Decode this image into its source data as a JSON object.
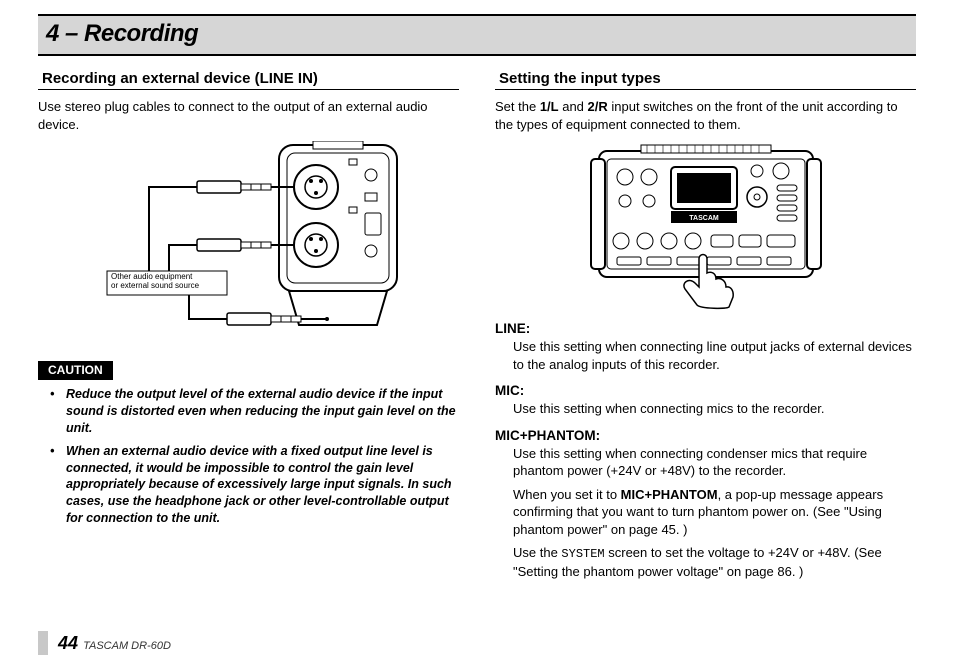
{
  "chapter": {
    "title": "4 – Recording"
  },
  "left": {
    "heading": "Recording an external device (LINE IN)",
    "intro": "Use stereo plug cables to connect to the output of an external audio device.",
    "diagram_callout_line1": "Other audio equipment",
    "diagram_callout_line2": "or external sound source",
    "caution_label": "CAUTION",
    "cautions": [
      "Reduce the output level of the external audio device if the input sound is distorted even when reducing the input gain level on the unit.",
      "When an external audio device with a fixed output line level is connected, it would be impossible to control the gain level appropriately because of excessively large input signals. In such cases, use the headphone jack or other level-controllable output for connection to the unit."
    ]
  },
  "right": {
    "heading": "Setting the input types",
    "intro_pre": "Set the ",
    "intro_bold1": "1/L",
    "intro_mid": " and ",
    "intro_bold2": "2/R",
    "intro_post": " input switches on the front of the unit according to the types of equipment connected to them.",
    "device_brand": "TASCAM",
    "settings": {
      "line": {
        "head": "LINE:",
        "body": "Use this setting when connecting line output jacks of external devices to the analog inputs of this recorder."
      },
      "mic": {
        "head": "MIC:",
        "body": "Use this setting when connecting mics to the recorder."
      },
      "phantom": {
        "head": "MIC+PHANTOM:",
        "body1": "Use this setting when connecting condenser mics that require phantom power (+24V or +48V) to the recorder.",
        "body2_pre": "When you set it to ",
        "body2_bold": "MIC+PHANTOM",
        "body2_post": ", a pop-up message appears confirming that you want to turn phantom power on. (See \"Using phantom power\" on page 45. )",
        "body3_pre": "Use the ",
        "body3_sys": "SYSTEM",
        "body3_post": " screen to set the voltage to +24V or +48V. (See \"Setting the phantom power voltage\" on page 86. )"
      }
    }
  },
  "footer": {
    "page": "44",
    "product": "TASCAM  DR-60D"
  }
}
